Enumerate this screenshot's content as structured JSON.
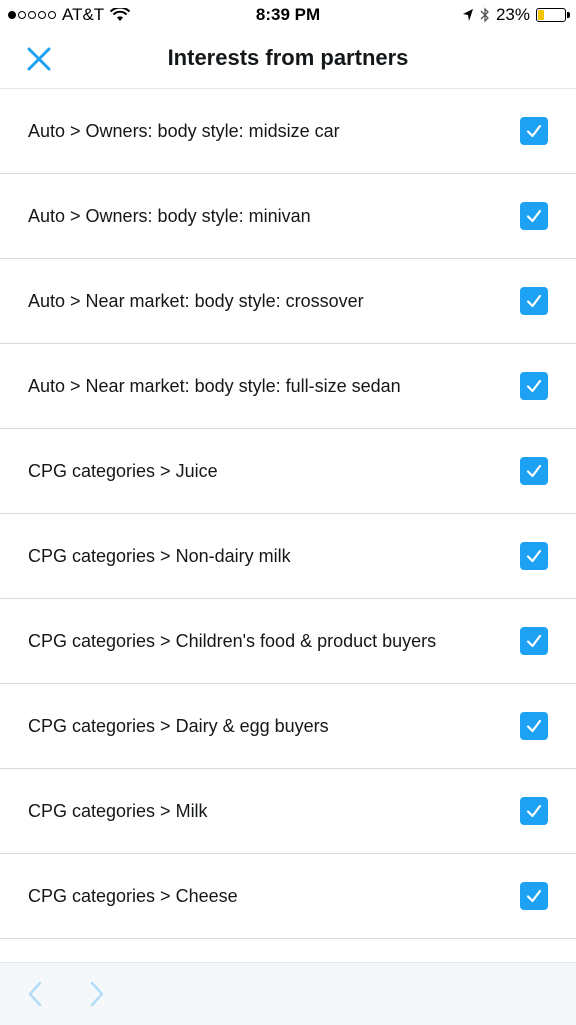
{
  "status_bar": {
    "carrier": "AT&T",
    "signal_bars": 1,
    "time": "8:39 PM",
    "battery_percent": "23%",
    "battery_level": 0.23
  },
  "header": {
    "title": "Interests from partners",
    "close_icon": "close-icon"
  },
  "rows": [
    {
      "label": "Auto > Owners: body style: midsize car",
      "checked": true
    },
    {
      "label": "Auto > Owners: body style: minivan",
      "checked": true
    },
    {
      "label": "Auto > Near market: body style: crossover",
      "checked": true
    },
    {
      "label": "Auto > Near market: body style: full-size sedan",
      "checked": true
    },
    {
      "label": "CPG categories > Juice",
      "checked": true
    },
    {
      "label": "CPG categories > Non-dairy milk",
      "checked": true
    },
    {
      "label": "CPG categories > Children's food & product buyers",
      "checked": true
    },
    {
      "label": "CPG categories > Dairy & egg buyers",
      "checked": true
    },
    {
      "label": "CPG categories > Milk",
      "checked": true
    },
    {
      "label": "CPG categories > Cheese",
      "checked": true
    }
  ],
  "toolbar": {
    "back_icon": "chevron-left-icon",
    "forward_icon": "chevron-right-icon"
  },
  "colors": {
    "accent": "#1da1f2",
    "divider": "#d3dce2",
    "text": "#14171a",
    "battery": "#f5c400"
  }
}
